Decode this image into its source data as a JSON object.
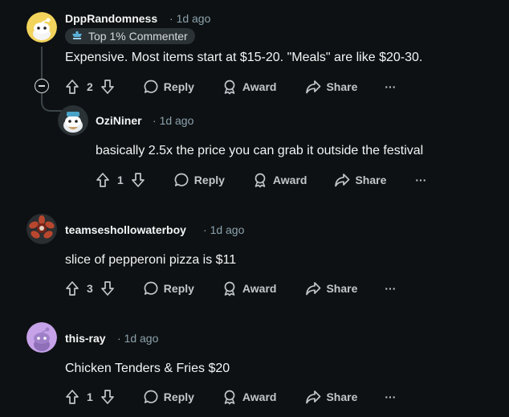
{
  "comments": [
    {
      "username": "DppRandomness",
      "time": "1d ago",
      "badge": "Top 1% Commenter",
      "text": "Expensive. Most items start at $15-20. \"Meals\" are like $20-30.",
      "votes": "2",
      "reply_label": "Reply",
      "award_label": "Award",
      "share_label": "Share",
      "more_label": "···"
    },
    {
      "username": "OziNiner",
      "time": "1d ago",
      "text": "basically 2.5x the price you can grab it outside the festival",
      "votes": "1",
      "reply_label": "Reply",
      "award_label": "Award",
      "share_label": "Share",
      "more_label": "···"
    },
    {
      "username": "teamseshollowaterboy",
      "time": "1d ago",
      "text": "slice of pepperoni pizza is $11",
      "votes": "3",
      "reply_label": "Reply",
      "award_label": "Award",
      "share_label": "Share",
      "more_label": "···"
    },
    {
      "username": "this-ray",
      "time": "1d ago",
      "text": "Chicken Tenders & Fries $20",
      "votes": "1",
      "reply_label": "Reply",
      "award_label": "Award",
      "share_label": "Share",
      "more_label": "···"
    }
  ],
  "colors": {
    "background": "#0e1113",
    "text": "#f2f4f5",
    "meta": "#8ba2ad",
    "badge_bg": "#2a3236"
  },
  "icons": [
    "avatar",
    "upvote-icon",
    "downvote-icon",
    "reply-icon",
    "award-icon",
    "share-icon",
    "more-icon",
    "collapse-icon",
    "badge-icon"
  ]
}
